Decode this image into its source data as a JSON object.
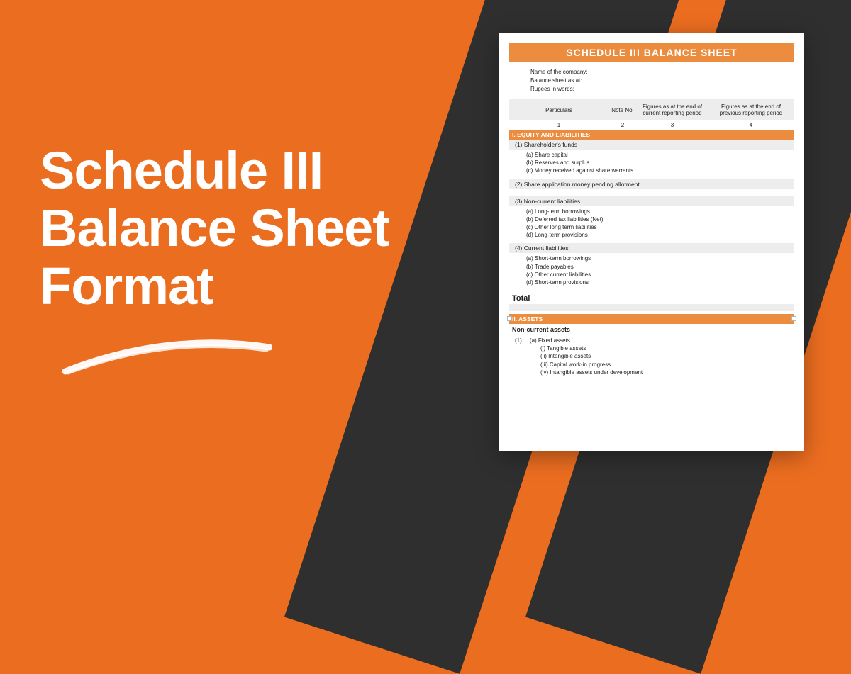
{
  "heading": {
    "line1": "Schedule III",
    "line2": "Balance Sheet",
    "line3": "Format"
  },
  "doc": {
    "title": "SCHEDULE III BALANCE SHEET",
    "meta": {
      "company": "Name of the company:",
      "asat": "Balance sheet as at:",
      "rupees": "Rupees in words:"
    },
    "header": {
      "c1": "Particulars",
      "c2": "Note No.",
      "c3": "Figures as at the end of current reporting period",
      "c4": "Figures as at the end of previous reporting period",
      "n1": "1",
      "n2": "2",
      "n3": "3",
      "n4": "4"
    },
    "section1": "I. EQUITY AND LIABILITIES",
    "g1": {
      "title": "(1) Shareholder's funds",
      "a": "(a) Share capital",
      "b": "(b) Reserves and surplus",
      "c": "(c) Money received against share warrants"
    },
    "g2": {
      "title": "(2) Share application money pending allotment"
    },
    "g3": {
      "title": "(3) Non-current liabilities",
      "a": "(a) Long-term borrowings",
      "b": "(b) Deferred tax liabilities (Net)",
      "c": "(c) Other long term liabilities",
      "d": "(d) Long-term provisions"
    },
    "g4": {
      "title": "(4) Current liabilities",
      "a": "(a) Short-term borrowings",
      "b": "(b) Trade payables",
      "c": "(c) Other current liabilities",
      "d": "(d) Short-term provisions"
    },
    "total": "Total",
    "section2": "II. ASSETS",
    "nca": "Non-current assets",
    "a1": {
      "num": "(1)",
      "fixed": "(a) Fixed assets",
      "i": "(i) Tangible assets",
      "ii": "(ii) Intangible assets",
      "iii": "(iii) Capital work-in progress",
      "iv": "(iv) Intangible assets under development"
    }
  }
}
